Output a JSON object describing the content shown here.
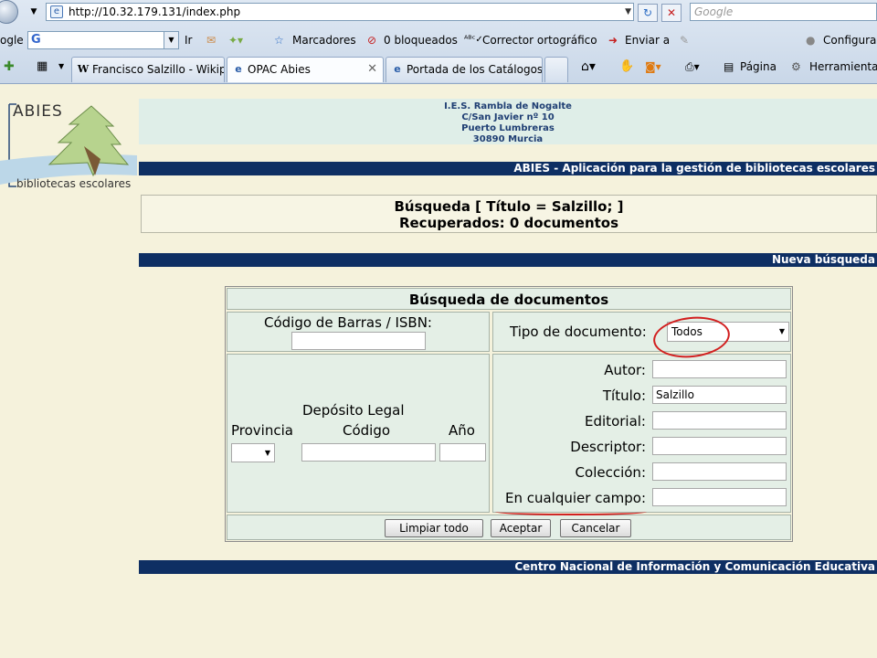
{
  "browser": {
    "url": "http://10.32.179.131/index.php",
    "search_placeholder": "Google",
    "toolbar": {
      "google_label": "ogle",
      "go_label": "Ir",
      "bookmarks_label": "Marcadores",
      "blocked_label": "0 bloqueados",
      "spellcheck_label": "Corrector ortográfico",
      "send_label": "Enviar a",
      "settings_label": "Configuraci",
      "page_label": "Página",
      "tools_label": "Herramientas"
    },
    "tabs": [
      {
        "label": "Francisco Salzillo - Wikip...",
        "icon": "W"
      },
      {
        "label": "OPAC Abies",
        "icon": "e"
      },
      {
        "label": "Portada de los Catálogos ...",
        "icon": "e"
      }
    ]
  },
  "logo": {
    "title": "ABIES",
    "subtitle": "bibliotecas escolares"
  },
  "school": {
    "name": "I.E.S. Rambla de Nogalte",
    "street": "C/San Javier nº 10",
    "town": "Puerto Lumbreras",
    "postal": "30890 Murcia"
  },
  "header_bar": "ABIES - Aplicación para la gestión de bibliotecas escolares",
  "result": {
    "query": "Búsqueda [ Título = Salzillo; ]",
    "count": "Recuperados: 0 documentos"
  },
  "new_search_bar": "Nueva búsqueda",
  "form": {
    "title": "Búsqueda de documentos",
    "barcode_label": "Código de Barras / ISBN:",
    "doc_type_label": "Tipo de documento:",
    "doc_type_value": "Todos",
    "legal_deposit_label": "Depósito Legal",
    "province_label": "Provincia",
    "code_label": "Código",
    "year_label": "Año",
    "author_label": "Autor:",
    "title_label": "Título:",
    "title_value": "Salzillo",
    "publisher_label": "Editorial:",
    "descriptor_label": "Descriptor:",
    "collection_label": "Colección:",
    "any_field_label": "En cualquier campo:",
    "clear_button": "Limpiar todo",
    "accept_button": "Aceptar",
    "cancel_button": "Cancelar"
  },
  "footer_bar": "Centro Nacional de Información y Comunicación Educativa",
  "colors": {
    "bar": "#0e2f63",
    "page": "#f5f2dc",
    "annotation": "#d21f1f"
  }
}
